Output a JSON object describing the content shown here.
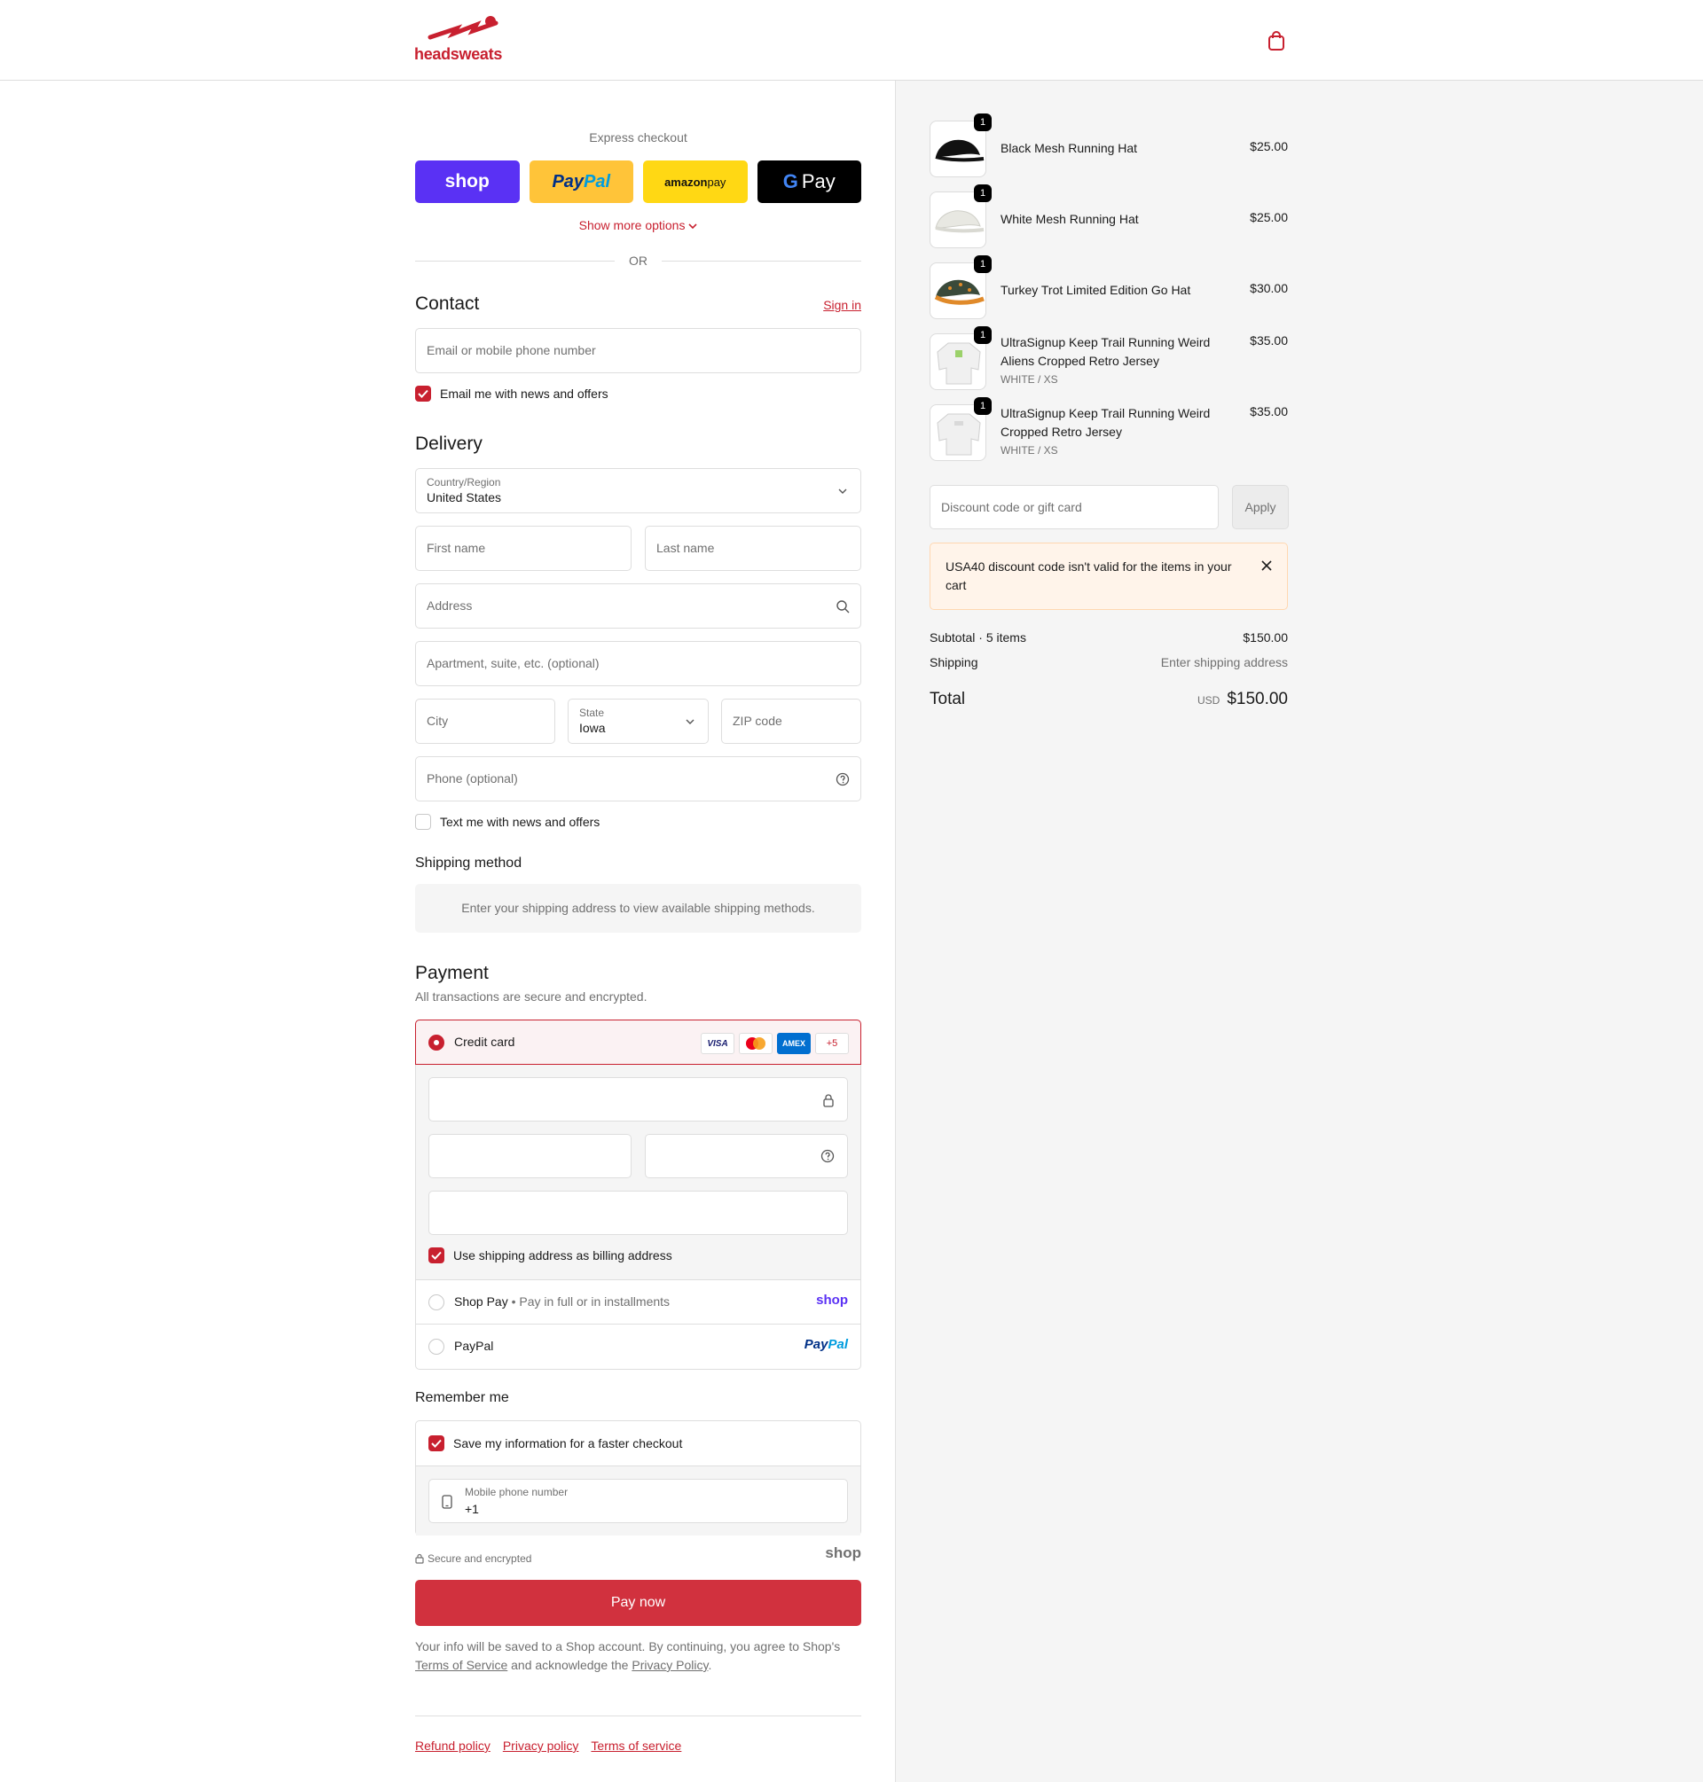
{
  "header": {
    "logo_text": "headsweats",
    "cart_icon": "shopping-bag-icon",
    "brand_color": "#c8202f"
  },
  "express": {
    "title": "Express checkout",
    "shop_label": "shop",
    "paypal_label_a": "Pay",
    "paypal_label_b": "Pal",
    "amazon_label_a": "amazon",
    "amazon_label_b": " pay",
    "gpay_label_g": "G",
    "gpay_label": "Pay",
    "show_more": "Show more options",
    "or": "OR"
  },
  "contact": {
    "title": "Contact",
    "sign_in": "Sign in",
    "email_placeholder": "Email or mobile phone number",
    "news_label": "Email me with news and offers",
    "news_checked": true
  },
  "delivery": {
    "title": "Delivery",
    "country_label": "Country/Region",
    "country_value": "United States",
    "first_name": "First name",
    "last_name": "Last name",
    "address": "Address",
    "apartment": "Apartment, suite, etc. (optional)",
    "city": "City",
    "state_label": "State",
    "state_value": "Iowa",
    "zip": "ZIP code",
    "phone": "Phone (optional)",
    "text_label": "Text me with news and offers",
    "text_checked": false
  },
  "shipping": {
    "title": "Shipping method",
    "info": "Enter your shipping address to view available shipping methods."
  },
  "payment": {
    "title": "Payment",
    "subtitle": "All transactions are secure and encrypted.",
    "credit_card": "Credit card",
    "card_visa": "VISA",
    "card_amex": "AMEX",
    "card_more": "+5",
    "billing_label": "Use shipping address as billing address",
    "billing_checked": true,
    "shop_pay": "Shop Pay",
    "shop_pay_sep": "•",
    "shop_pay_sub": "Pay in full or in installments",
    "shop_pay_brand": "shop",
    "paypal": "PayPal",
    "paypal_brand_a": "Pay",
    "paypal_brand_b": "Pal"
  },
  "remember": {
    "title": "Remember me",
    "save_label": "Save my information for a faster checkout",
    "save_checked": true,
    "mobile_label": "Mobile phone number",
    "mobile_value": "+1",
    "secure_label": "Secure and encrypted",
    "shop_brand": "shop"
  },
  "pay_now": "Pay now",
  "legal": {
    "text_a": "Your info will be saved to a Shop account. By continuing, you agree to Shop's",
    "terms": "Terms of Service",
    "text_b": "and acknowledge the",
    "privacy": "Privacy Policy",
    "text_c": "."
  },
  "footer": {
    "links": [
      "Refund policy",
      "Privacy policy",
      "Terms of service"
    ]
  },
  "cart": {
    "items": [
      {
        "qty": "1",
        "name": "Black Mesh Running Hat",
        "variant": "",
        "price": "$25.00"
      },
      {
        "qty": "1",
        "name": "White Mesh Running Hat",
        "variant": "",
        "price": "$25.00"
      },
      {
        "qty": "1",
        "name": "Turkey Trot Limited Edition Go Hat",
        "variant": "",
        "price": "$30.00"
      },
      {
        "qty": "1",
        "name": "UltraSignup Keep Trail Running Weird Aliens Cropped Retro Jersey",
        "variant": "WHITE / XS",
        "price": "$35.00"
      },
      {
        "qty": "1",
        "name": "UltraSignup Keep Trail Running Weird Cropped Retro Jersey",
        "variant": "WHITE / XS",
        "price": "$35.00"
      }
    ],
    "discount_placeholder": "Discount code or gift card",
    "apply": "Apply",
    "alert": "USA40 discount code isn't valid for the items in your cart",
    "subtotal_label": "Subtotal · 5 items",
    "subtotal": "$150.00",
    "shipping_label": "Shipping",
    "shipping_value": "Enter shipping address",
    "total_label": "Total",
    "currency": "USD",
    "total": "$150.00"
  }
}
